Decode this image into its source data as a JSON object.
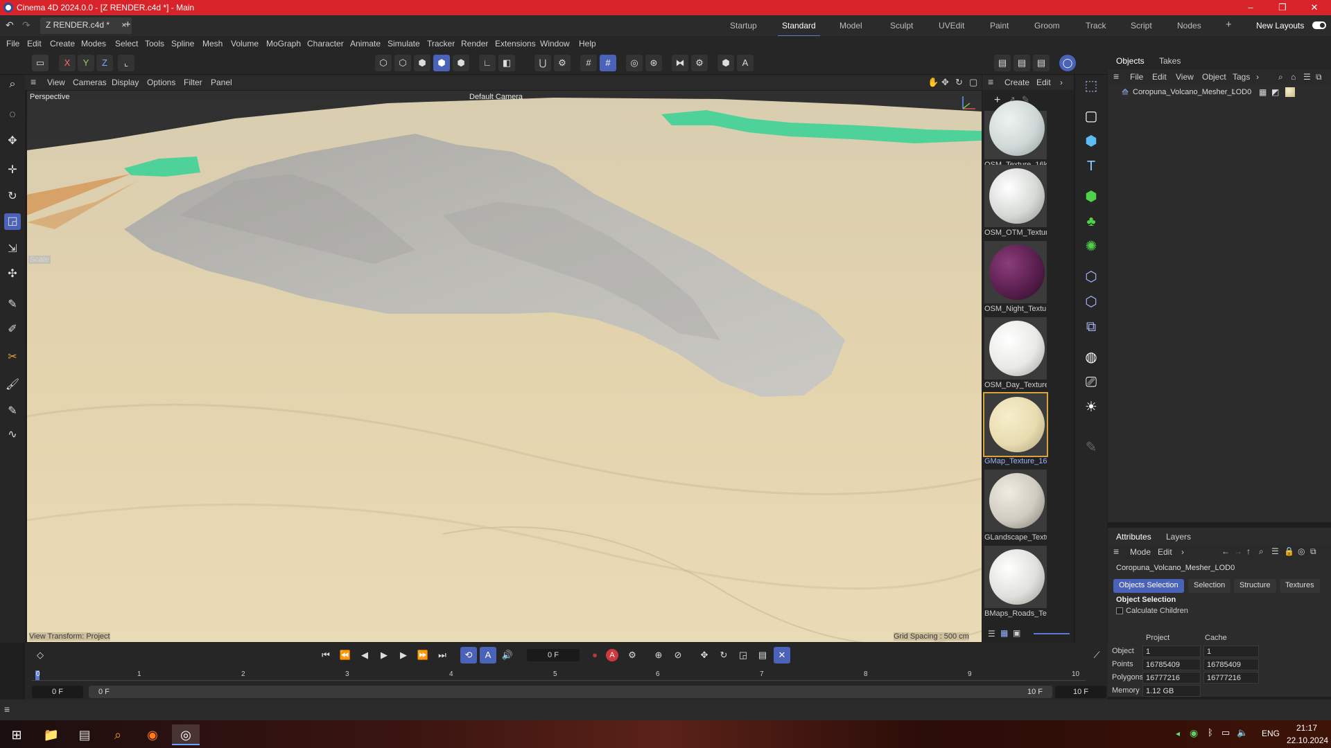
{
  "window": {
    "title": "Cinema 4D 2024.0.0 - [Z RENDER.c4d *] - Main",
    "minimize": "–",
    "maximize": "❐",
    "close": "✕"
  },
  "doc_tab": {
    "name": "Z RENDER.c4d *",
    "close": "×",
    "add": "+"
  },
  "layouts": {
    "items": [
      "Startup",
      "Standard",
      "Model",
      "Sculpt",
      "UVEdit",
      "Paint",
      "Groom",
      "Track",
      "Script",
      "Nodes"
    ],
    "active_index": 1,
    "add": "+",
    "new_layouts": "New Layouts"
  },
  "menu": [
    "File",
    "Edit",
    "Create",
    "Modes",
    "Select",
    "Tools",
    "Spline",
    "Mesh",
    "Volume",
    "MoGraph",
    "Character",
    "Animate",
    "Simulate",
    "Tracker",
    "Render",
    "Extensions",
    "Window",
    "Help"
  ],
  "axis_buttons": [
    "X",
    "Y",
    "Z"
  ],
  "viewport_menu": [
    "View",
    "Cameras",
    "Display",
    "Options",
    "Filter",
    "Panel"
  ],
  "viewport": {
    "view_name": "Perspective",
    "camera": "Default Camera",
    "view_transform": "View Transform: Project",
    "grid_spacing": "Grid Spacing : 500 cm",
    "scale_hint": "Scale"
  },
  "material_panel": {
    "create": "Create",
    "edit": "Edit",
    "materials": [
      {
        "name": "OSM_Texture_16k",
        "color": "#cfd8d6"
      },
      {
        "name": "OSM_OTM_Textur",
        "color": "#d6d9d6"
      },
      {
        "name": "OSM_Night_Textu",
        "color": "#5a1f4e"
      },
      {
        "name": "OSM_Day_Texture",
        "color": "#e9e9e6"
      },
      {
        "name": "GMap_Texture_16",
        "color": "#e8dcb0",
        "selected": true
      },
      {
        "name": "GLandscape_Textu",
        "color": "#d0cbc0"
      },
      {
        "name": "BMaps_Roads_Tex",
        "color": "#e0e0dc"
      }
    ]
  },
  "objects_panel": {
    "tabs": [
      "Objects",
      "Takes"
    ],
    "menu": [
      "File",
      "Edit",
      "View",
      "Object",
      "Tags"
    ],
    "object_name": "Coropuna_Volcano_Mesher_LOD0"
  },
  "attributes_panel": {
    "tabs": [
      "Attributes",
      "Layers"
    ],
    "menu": [
      "Mode",
      "Edit"
    ],
    "object_name": "Coropuna_Volcano_Mesher_LOD0",
    "subtabs": [
      "Objects Selection",
      "Selection",
      "Structure",
      "Textures"
    ],
    "section_title": "Object Selection",
    "calculate_children": "Calculate Children",
    "columns": [
      "Project",
      "Cache"
    ],
    "rows": [
      {
        "label": "Object",
        "project": "1",
        "cache": "1"
      },
      {
        "label": "Points",
        "project": "16785409",
        "cache": "16785409"
      },
      {
        "label": "Polygons",
        "project": "16777216",
        "cache": "16777216"
      },
      {
        "label": "Memory",
        "project": "1.12 GB",
        "cache": ""
      }
    ]
  },
  "timeline": {
    "current_frame": "0 F",
    "ticks": [
      "0",
      "1",
      "2",
      "3",
      "4",
      "5",
      "6",
      "7",
      "8",
      "9",
      "10"
    ],
    "start_frame": "0 F",
    "preview_start": "0 F",
    "preview_end": "10 F",
    "end_frame": "10 F"
  },
  "taskbar": {
    "lang": "ENG",
    "time": "21:17",
    "date": "22.10.2024"
  },
  "colors": {
    "title_bar": "#d8232a",
    "accent": "#4a63b8",
    "terrain": "#e6d8b4",
    "volcano": "#b9b8b3",
    "green_patch": "#4fd29a",
    "orange_patch": "#d69a5a"
  }
}
